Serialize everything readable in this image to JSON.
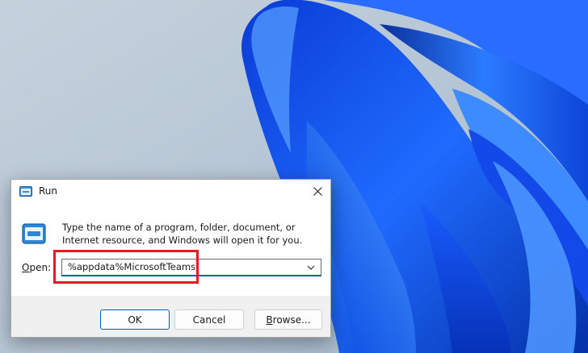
{
  "window": {
    "title": "Run",
    "icon": "run-icon",
    "close": "close-icon"
  },
  "dialog": {
    "description": "Type the name of a program, folder, document, or Internet resource, and Windows will open it for you.",
    "open_label_prefix": "",
    "open_label_access_key": "O",
    "open_label_rest": "pen:",
    "input_value": "%appdata%MicrosoftTeams"
  },
  "buttons": {
    "ok": "OK",
    "cancel": "Cancel",
    "browse_access_key": "B",
    "browse_rest": "rowse..."
  },
  "colors": {
    "accent": "#005fb8",
    "highlight": "#e21b23",
    "footer": "#f0f0f0"
  }
}
